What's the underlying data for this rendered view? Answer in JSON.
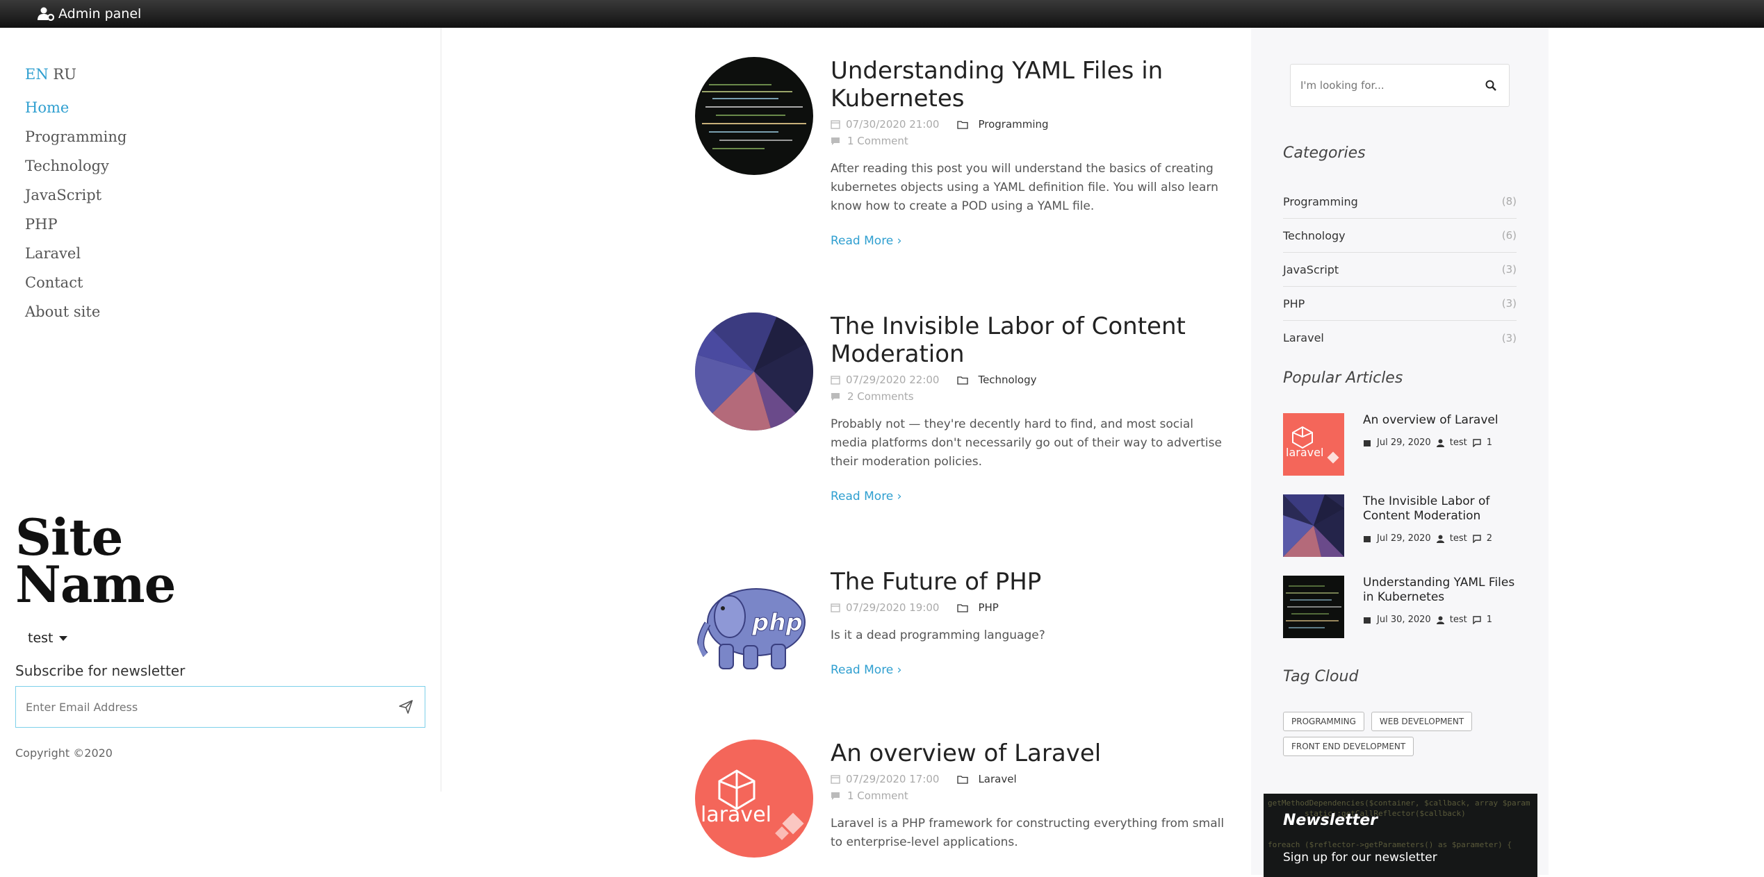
{
  "topbar": {
    "admin_label": "Admin panel"
  },
  "sidebar_left": {
    "lang_en": "EN",
    "lang_ru": "RU",
    "nav": [
      "Home",
      "Programming",
      "Technology",
      "JavaScript",
      "PHP",
      "Laravel",
      "Contact",
      "About site"
    ],
    "site_name_line1": "Site",
    "site_name_line2": "Name",
    "user": "test",
    "subscribe_title": "Subscribe for newsletter",
    "subscribe_placeholder": "Enter Email Address",
    "copyright": "Copyright ©2020"
  },
  "posts": [
    {
      "title": "Understanding YAML Files in Kubernetes",
      "date": "07/30/2020 21:00",
      "category": "Programming",
      "comments": "1 Comment",
      "excerpt": "After reading this post you will understand the basics of creating kubernetes objects using a YAML definition file. You will also learn know how to create a POD using a YAML file.",
      "read_more": "Read More"
    },
    {
      "title": "The Invisible Labor of Content Moderation",
      "date": "07/29/2020 22:00",
      "category": "Technology",
      "comments": "2 Comments",
      "excerpt": "Probably not — they're decently hard to find, and most social media platforms don't necessarily go out of their way to advertise their moderation policies.",
      "read_more": "Read More"
    },
    {
      "title": "The Future of PHP",
      "date": "07/29/2020 19:00",
      "category": "PHP",
      "excerpt": "Is it a dead programming language?",
      "read_more": "Read More"
    },
    {
      "title": "An overview of Laravel",
      "date": "07/29/2020 17:00",
      "category": "Laravel",
      "comments": "1 Comment",
      "excerpt": "Laravel is a PHP framework for constructing everything from small to enterprise-level applications.",
      "read_more": "Read More"
    }
  ],
  "sidebar_right": {
    "search_placeholder": "I'm looking for...",
    "categories_title": "Categories",
    "categories": [
      {
        "name": "Programming",
        "count": "(8)"
      },
      {
        "name": "Technology",
        "count": "(6)"
      },
      {
        "name": "JavaScript",
        "count": "(3)"
      },
      {
        "name": "PHP",
        "count": "(3)"
      },
      {
        "name": "Laravel",
        "count": "(3)"
      }
    ],
    "popular_title": "Popular Articles",
    "popular": [
      {
        "title": "An overview of Laravel",
        "date": "Jul 29, 2020",
        "author": "test",
        "comments": "1"
      },
      {
        "title": "The Invisible Labor of Content Moderation",
        "date": "Jul 29, 2020",
        "author": "test",
        "comments": "2"
      },
      {
        "title": "Understanding YAML Files in Kubernetes",
        "date": "Jul 30, 2020",
        "author": "test",
        "comments": "1"
      }
    ],
    "tagcloud_title": "Tag Cloud",
    "tags": [
      "PROGRAMMING",
      "WEB DEVELOPMENT",
      "FRONT END DEVELOPMENT"
    ],
    "newsletter_title": "Newsletter",
    "newsletter_text": "Sign up for our newsletter"
  },
  "icons": {
    "admin": "user-gear-icon",
    "send": "paper-plane-icon",
    "search": "search-icon",
    "calendar": "calendar-icon",
    "folder": "folder-icon",
    "comment": "comment-icon",
    "user": "user-icon"
  },
  "colors": {
    "accent": "#2f9fd0",
    "topbar": "#1a1a1a",
    "laravel": "#f4665a"
  }
}
